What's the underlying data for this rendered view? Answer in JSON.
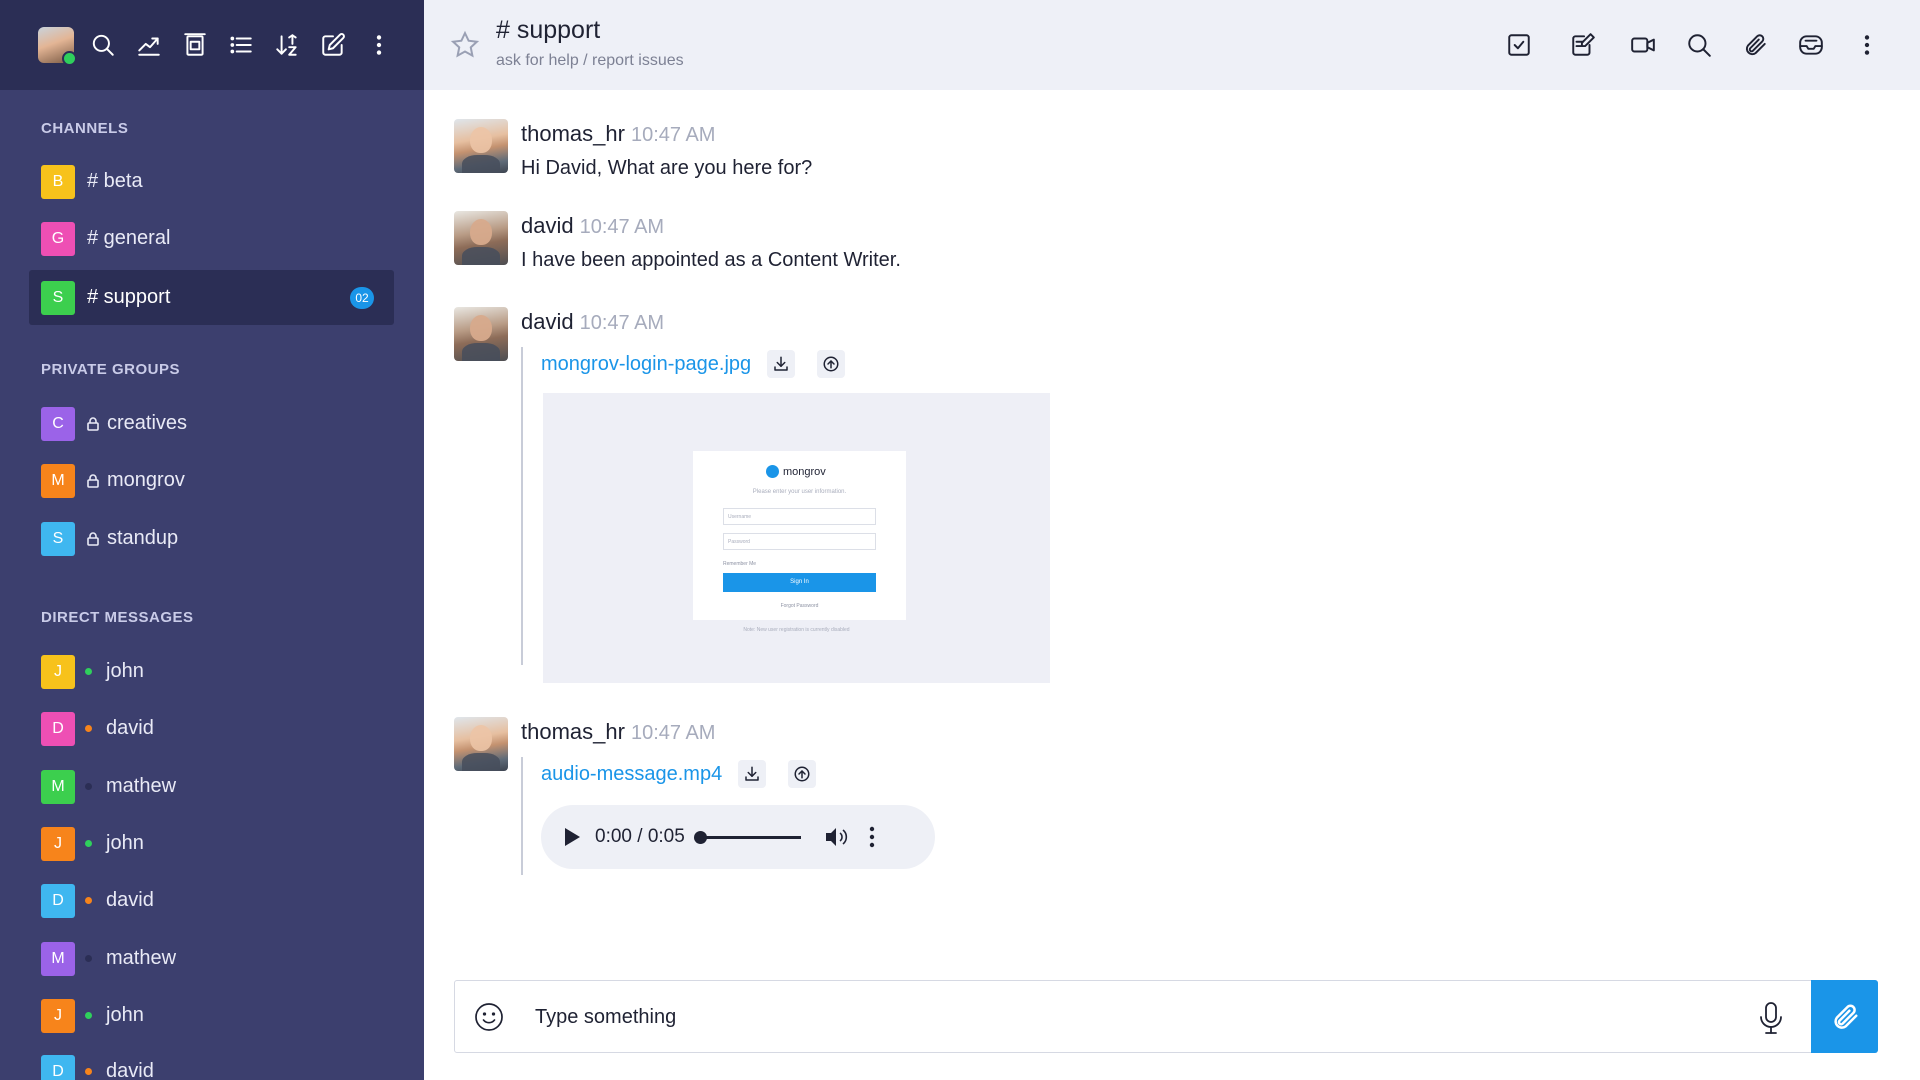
{
  "sidebar": {
    "sections": {
      "channels": "CHANNELS",
      "private_groups": "PRIVATE GROUPS",
      "direct_messages": "DIRECT MESSAGES"
    },
    "channels": [
      {
        "letter": "B",
        "label": "# beta",
        "color": "#f7c21b"
      },
      {
        "letter": "G",
        "label": "# general",
        "color": "#ee4fb4"
      },
      {
        "letter": "S",
        "label": "# support",
        "color": "#3ccf4e",
        "badge": "02",
        "active": true
      }
    ],
    "private_groups": [
      {
        "letter": "C",
        "label": "creatives",
        "color": "#9b63e8"
      },
      {
        "letter": "M",
        "label": "mongrov",
        "color": "#f7841b"
      },
      {
        "letter": "S",
        "label": "standup",
        "color": "#3fb7f0"
      }
    ],
    "direct_messages": [
      {
        "letter": "J",
        "label": "john",
        "color": "#f7c21b",
        "status": "#2fd05c"
      },
      {
        "letter": "D",
        "label": "david",
        "color": "#ee4fb4",
        "status": "#f7841b"
      },
      {
        "letter": "M",
        "label": "mathew",
        "color": "#3ccf4e",
        "status": "#2b2e55"
      },
      {
        "letter": "J",
        "label": "john",
        "color": "#f7841b",
        "status": "#2fd05c"
      },
      {
        "letter": "D",
        "label": "david",
        "color": "#3fb7f0",
        "status": "#f7841b"
      },
      {
        "letter": "M",
        "label": "mathew",
        "color": "#9b63e8",
        "status": "#2b2e55"
      },
      {
        "letter": "J",
        "label": "john",
        "color": "#f7841b",
        "status": "#2fd05c"
      },
      {
        "letter": "D",
        "label": "david",
        "color": "#3fb7f0",
        "status": "#f7841b"
      }
    ]
  },
  "header": {
    "title": "# support",
    "subtitle": "ask for help / report issues"
  },
  "messages": [
    {
      "user": "thomas_hr",
      "time": "10:47 AM",
      "text": "Hi David, What are you here for?"
    },
    {
      "user": "david",
      "time": "10:47 AM",
      "text": "I have been appointed as a Content Writer."
    },
    {
      "user": "david",
      "time": "10:47 AM",
      "file": "mongrov-login-page.jpg",
      "preview": {
        "logo": "mongrov",
        "subtitle": "Please enter your user information.",
        "username_placeholder": "Username",
        "password_placeholder": "Password",
        "remember": "Remember Me",
        "button": "Sign In",
        "forgot": "Forgot Password",
        "note": "Note: New user registration is currently disabled"
      }
    },
    {
      "user": "thomas_hr",
      "time": "10:47 AM",
      "file": "audio-message.mp4",
      "audio": {
        "current": "0:00",
        "duration": "0:05",
        "progress": 0
      }
    }
  ],
  "composer": {
    "placeholder": "Type something"
  },
  "colors": {
    "sidebar_bg": "#3c3f6e",
    "sidebar_dark": "#2b2e55",
    "accent": "#1a95e8"
  }
}
